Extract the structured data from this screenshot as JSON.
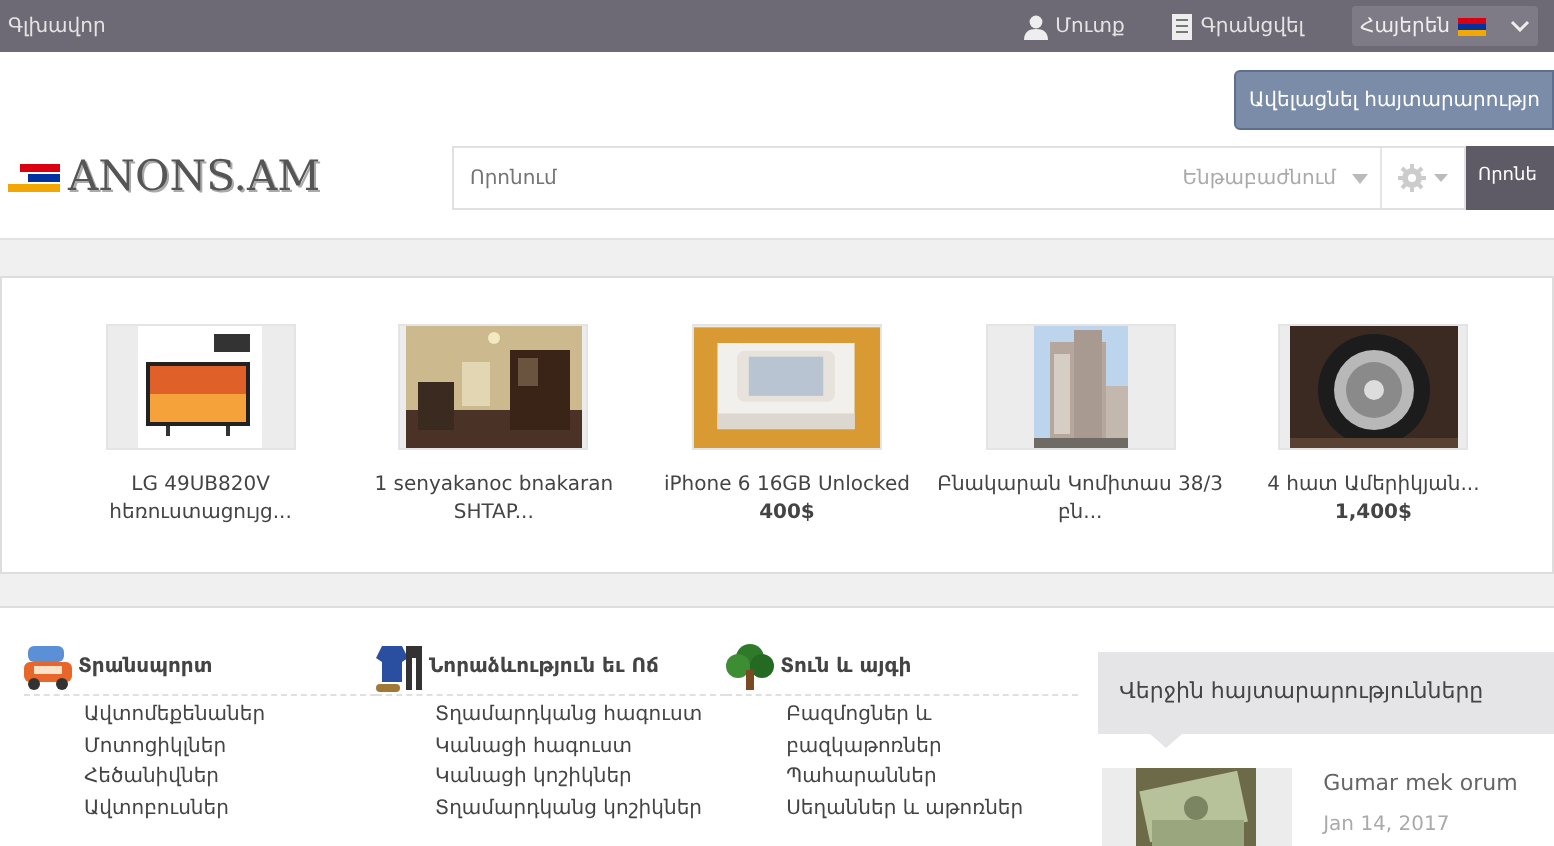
{
  "topbar": {
    "home": "Գլխավոր",
    "login": "Մուտք",
    "register": "Գրանցվել",
    "language": "Հայերեն"
  },
  "header": {
    "add_button": "Ավելացնել հայտարարությո",
    "logo": "ANONS.AM",
    "search": {
      "placeholder": "Որոնում",
      "category_placeholder": "Ենթաբաժնում",
      "button": "Որոնե"
    }
  },
  "products": [
    {
      "title": "LG 49UB820V հեռուստացույց..."
    },
    {
      "title": "1 senyakanoc bnakaran SHTAP..."
    },
    {
      "title": "iPhone 6 16GB Unlocked",
      "price": "400$"
    },
    {
      "title": "Բնակարան Կոմիտաս 38/3 բն..."
    },
    {
      "title": "4 հատ Ամերիկյան...",
      "price": "1,400$"
    }
  ],
  "categories": [
    {
      "title": "Տրանսպորտ",
      "items": [
        "Ավտոմեքենաներ",
        "Մոտոցիկլներ",
        "Հեծանիվներ",
        "Ավտոբուսներ"
      ]
    },
    {
      "title": "Նորաձևություն եւ Ոճ",
      "items": [
        "Տղամարդկանց հագուստ",
        "Կանացի հագուստ",
        "Կանացի կոշիկներ",
        "Տղամարդկանց կոշիկներ"
      ]
    },
    {
      "title": "Տուն և այգի",
      "items": [
        "Բազմոցներ և բազկաթոռներ",
        "Պահարաններ",
        "Սեղաններ և աթոռներ"
      ]
    }
  ],
  "latest": {
    "heading": "Վերջին հայտարարությունները",
    "items": [
      {
        "title": "Gumar mek orum",
        "date": "Jan 14, 2017",
        "kind": "picture"
      }
    ]
  }
}
